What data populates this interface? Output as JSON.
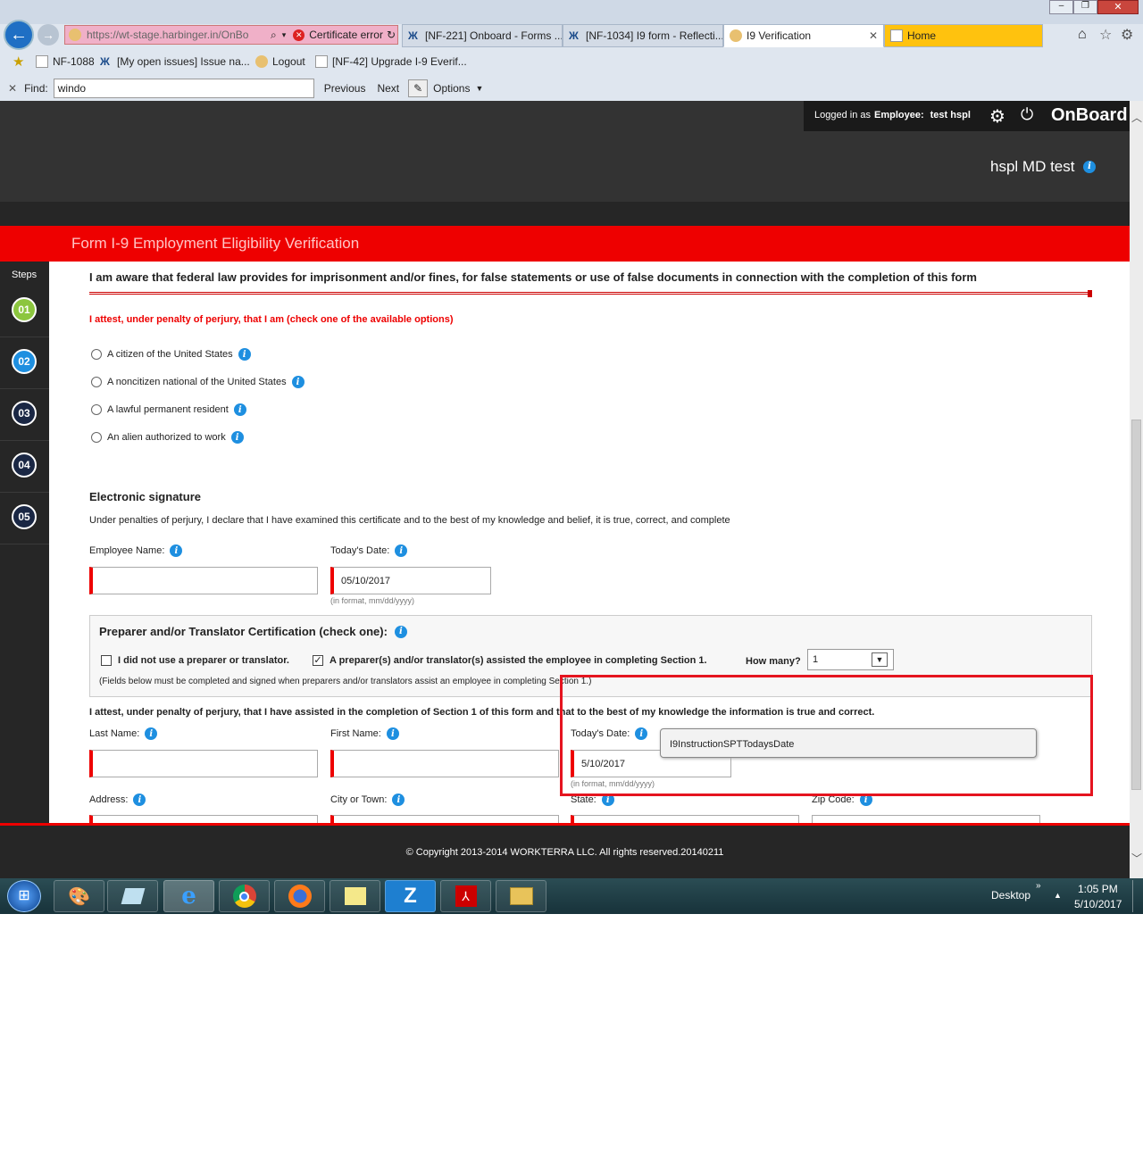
{
  "browser": {
    "address_url": "https://wt-stage.harbinger.in/OnBo",
    "cert_error": "Certificate error",
    "tabs": [
      {
        "label": "[NF-221] Onboard - Forms ..."
      },
      {
        "label": "[NF-1034] I9 form - Reflecti..."
      },
      {
        "label": "I9 Verification"
      },
      {
        "label": "Home"
      }
    ],
    "bookmarks": [
      {
        "label": "NF-1088"
      },
      {
        "label": "[My open issues] Issue na..."
      },
      {
        "label": "Logout"
      },
      {
        "label": "[NF-42] Upgrade I-9 Everif..."
      }
    ],
    "find": {
      "label": "Find:",
      "value": "windo",
      "previous": "Previous",
      "next": "Next",
      "options": "Options"
    }
  },
  "header": {
    "logged_in_prefix": "Logged in as",
    "role": "Employee:",
    "user": "test hspl",
    "brand": "OnBoard",
    "company": "hspl MD test"
  },
  "page_title": "Form I-9 Employment Eligibility Verification",
  "steps": {
    "label": "Steps",
    "items": [
      {
        "num": "01",
        "color": "#8cc63f"
      },
      {
        "num": "02",
        "color": "#1e8fe0"
      },
      {
        "num": "03",
        "color": "#1a2744"
      },
      {
        "num": "04",
        "color": "#1a2744"
      },
      {
        "num": "05",
        "color": "#1a2744"
      }
    ]
  },
  "form": {
    "warning": "I am aware that federal law provides for imprisonment and/or fines, for false statements or use of false documents in connection with the completion of this form",
    "attest_heading": "I attest, under penalty of perjury, that I am (check one of the available options)",
    "options": [
      {
        "label": "A citizen of the United States"
      },
      {
        "label": "A noncitizen national of the United States"
      },
      {
        "label": "A lawful permanent resident"
      },
      {
        "label": "An alien authorized to work"
      }
    ],
    "esig_heading": "Electronic signature",
    "esig_text": "Under penalties of perjury, I declare that I have examined this certificate and to the best of my knowledge and belief, it is true, correct, and complete",
    "employee_name_label": "Employee Name:",
    "employee_name_value": "",
    "todays_date_label": "Today's Date:",
    "todays_date_value": "05/10/2017",
    "date_hint": "(in format, mm/dd/yyyy)",
    "prep_heading": "Preparer and/or Translator Certification (check one):",
    "prep_no_label": "I did not use a preparer or translator.",
    "prep_yes_label": "A preparer(s) and/or translator(s) assisted the employee in completing Section 1.",
    "how_many_label": "How many?",
    "how_many_value": "1",
    "prep_note": "(Fields below must be completed and signed when preparers and/or translators assist an employee in completing Section 1.)",
    "prep_attest": "I attest, under penalty of perjury, that I have assisted in the completion of Section 1 of this form and that to the best of my knowledge the information is true and correct.",
    "last_name_label": "Last Name:",
    "first_name_label": "First Name:",
    "prep_date_label": "Today's Date:",
    "prep_date_value": "5/10/2017",
    "tooltip": "I9InstructionSPTTodaysDate",
    "address_label": "Address:",
    "city_label": "City or Town:",
    "state_label": "State:",
    "zip_label": "Zip Code:"
  },
  "footer": "© Copyright 2013-2014 WORKTERRA LLC. All rights reserved.20140211",
  "taskbar": {
    "desktop": "Desktop",
    "time": "1:05 PM",
    "date": "5/10/2017"
  }
}
